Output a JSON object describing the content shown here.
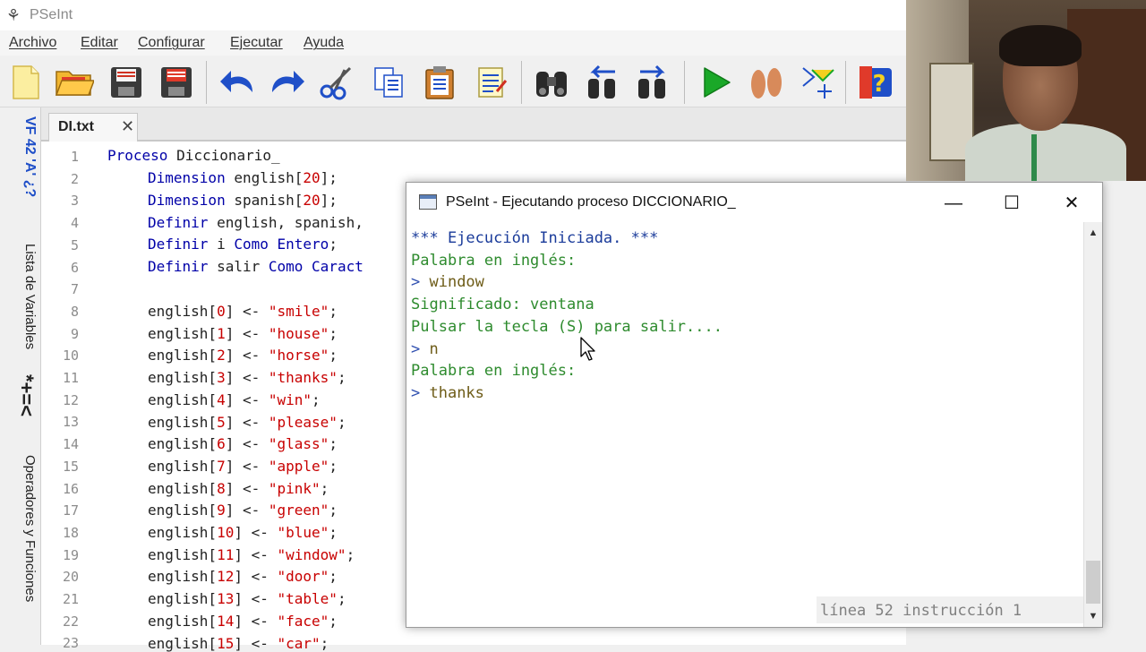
{
  "app": {
    "title": "PSeInt",
    "icon": "pseint-logo-icon"
  },
  "menu": [
    "Archivo",
    "Editar",
    "Configurar",
    "Ejecutar",
    "Ayuda"
  ],
  "toolbar": [
    "new-file-icon",
    "open-folder-icon",
    "save-icon",
    "save-as-icon",
    "undo-icon",
    "redo-icon",
    "cut-icon",
    "copy-icon",
    "paste-icon",
    "edit-list-icon",
    "find-binoculars-icon",
    "find-prev-icon",
    "find-next-icon",
    "run-icon",
    "step-by-step-icon",
    "flowchart-icon",
    "help-icon"
  ],
  "sidepanel": {
    "symbols": "VF 42 'A' ¿?",
    "variables_label": "Lista de Variables",
    "ops_symbols": "*+=<",
    "ops_label": "Operadores y Funciones"
  },
  "tab": {
    "label": "DI.txt",
    "close": "✕"
  },
  "editor": {
    "lines": [
      {
        "n": "1"
      },
      {
        "n": "2"
      },
      {
        "n": "3"
      },
      {
        "n": "4"
      },
      {
        "n": "5"
      },
      {
        "n": "6"
      },
      {
        "n": "7"
      },
      {
        "n": "8"
      },
      {
        "n": "9"
      },
      {
        "n": "10"
      },
      {
        "n": "11"
      },
      {
        "n": "12"
      },
      {
        "n": "13"
      },
      {
        "n": "14"
      },
      {
        "n": "15"
      },
      {
        "n": "16"
      },
      {
        "n": "17"
      },
      {
        "n": "18"
      },
      {
        "n": "19"
      },
      {
        "n": "20"
      },
      {
        "n": "21"
      },
      {
        "n": "22"
      },
      {
        "n": "23"
      }
    ],
    "code": {
      "l1_kw": "Proceso",
      "l1_rest": " Diccionario_",
      "l2_kw": "Dimension",
      "l2_a": " english[",
      "l2_num": "20",
      "l2_b": "];",
      "l3_kw": "Dimension",
      "l3_a": " spanish[",
      "l3_num": "20",
      "l3_b": "];",
      "l4_kw": "Definir",
      "l4_a": " english, spanish,",
      "l5_kw": "Definir",
      "l5_a": " i ",
      "l5_kw2": "Como Entero",
      "l5_b": ";",
      "l6_kw": "Definir",
      "l6_a": " salir ",
      "l6_kw2": "Como Caract",
      "assign": [
        {
          "idx": "0",
          "word": "\"smile\""
        },
        {
          "idx": "1",
          "word": "\"house\""
        },
        {
          "idx": "2",
          "word": "\"horse\""
        },
        {
          "idx": "3",
          "word": "\"thanks\""
        },
        {
          "idx": "4",
          "word": "\"win\""
        },
        {
          "idx": "5",
          "word": "\"please\""
        },
        {
          "idx": "6",
          "word": "\"glass\""
        },
        {
          "idx": "7",
          "word": "\"apple\""
        },
        {
          "idx": "8",
          "word": "\"pink\""
        },
        {
          "idx": "9",
          "word": "\"green\""
        },
        {
          "idx": "10",
          "word": "\"blue\""
        },
        {
          "idx": "11",
          "word": "\"window\""
        },
        {
          "idx": "12",
          "word": "\"door\""
        },
        {
          "idx": "13",
          "word": "\"table\""
        },
        {
          "idx": "14",
          "word": "\"face\""
        },
        {
          "idx": "15",
          "word": "\"car\""
        }
      ]
    }
  },
  "console": {
    "title": "PSeInt - Ejecutando proceso DICCIONARIO_",
    "controls": {
      "minimize": "—",
      "maximize": "☐",
      "close": "✕"
    },
    "lines": [
      {
        "text": "*** Ejecución Iniciada. ***",
        "kind": "head"
      },
      {
        "text": "Palabra en inglés:",
        "kind": "out"
      },
      {
        "prompt": ">",
        "text": " window",
        "kind": "in"
      },
      {
        "text": "Significado: ventana",
        "kind": "out"
      },
      {
        "text": "Pulsar la tecla (S) para salir....",
        "kind": "out"
      },
      {
        "prompt": ">",
        "text": " n",
        "kind": "in"
      },
      {
        "text": "Palabra en inglés:",
        "kind": "out"
      },
      {
        "prompt": ">",
        "text": " thanks",
        "kind": "in"
      }
    ],
    "status": "línea 52 instrucción 1"
  }
}
